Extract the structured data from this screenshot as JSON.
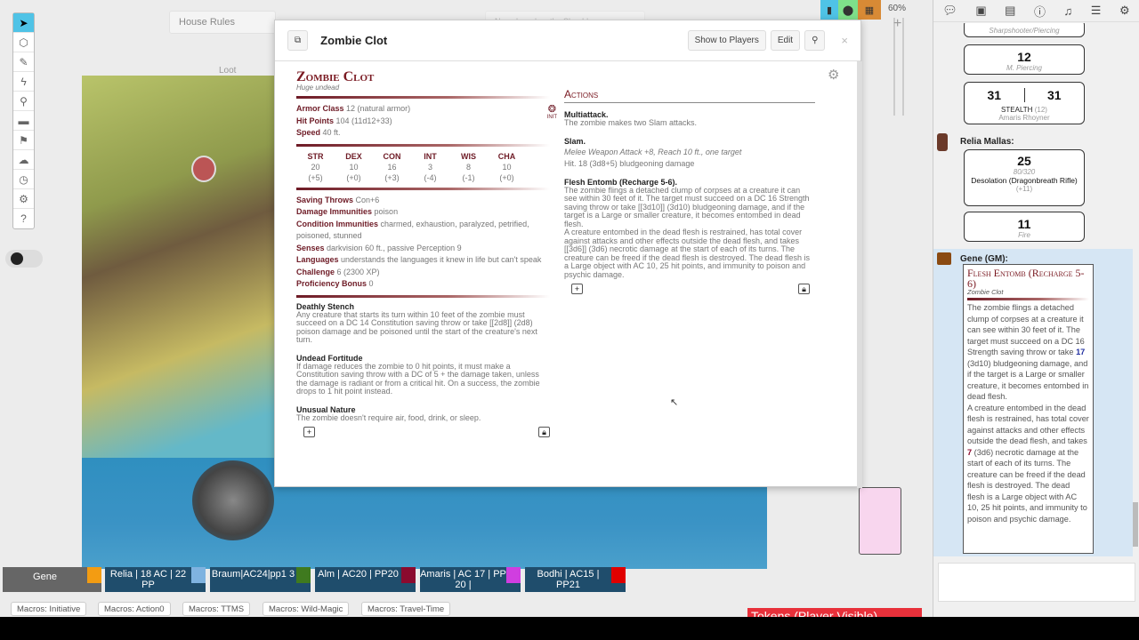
{
  "toolbar": {
    "icons": [
      "select-icon",
      "cube-icon",
      "brush-icon",
      "lightning-icon",
      "zoom-icon",
      "ruler-icon",
      "pin-icon",
      "fog-icon",
      "clock-icon",
      "dice-icon",
      "help-icon"
    ]
  },
  "pages": {
    "house_rules": "House Rules",
    "loot": "Loot",
    "shoulder": "Nemehaerd on the Shoulde"
  },
  "zoom": {
    "level": "60%"
  },
  "dialog": {
    "title": "Zombie Clot",
    "show_to_players": "Show to Players",
    "edit": "Edit"
  },
  "monster": {
    "name": "Zombie Clot",
    "type": "Huge undead",
    "ac_label": "Armor Class",
    "ac": "12 (natural armor)",
    "hp_label": "Hit Points",
    "hp": "104 (11d12+33)",
    "speed_label": "Speed",
    "speed": "40 ft.",
    "init": "INIT",
    "abilities": [
      {
        "n": "STR",
        "v": "20",
        "m": "(+5)"
      },
      {
        "n": "DEX",
        "v": "10",
        "m": "(+0)"
      },
      {
        "n": "CON",
        "v": "16",
        "m": "(+3)"
      },
      {
        "n": "INT",
        "v": "3",
        "m": "(-4)"
      },
      {
        "n": "WIS",
        "v": "8",
        "m": "(-1)"
      },
      {
        "n": "CHA",
        "v": "10",
        "m": "(+0)"
      }
    ],
    "props": [
      {
        "k": "Saving Throws",
        "v": "Con+6"
      },
      {
        "k": "Damage Immunities",
        "v": "poison"
      },
      {
        "k": "Condition Immunities",
        "v": "charmed, exhaustion, paralyzed, petrified, poisoned, stunned"
      },
      {
        "k": "Senses",
        "v": "darkvision 60 ft., passive Perception 9"
      },
      {
        "k": "Languages",
        "v": "understands the languages it knew in life but can't speak"
      },
      {
        "k": "Challenge",
        "v": "6 (2300 XP)"
      },
      {
        "k": "Proficiency Bonus",
        "v": "0"
      }
    ],
    "traits": [
      {
        "name": "Deathly Stench",
        "text": "Any creature that starts its turn within 10 feet of the zombie must succeed on a DC 14 Constitution saving throw or take [[2d8]] (2d8) poison damage and be poisoned until the start of the creature's next turn."
      },
      {
        "name": "Undead Fortitude",
        "text": "If damage reduces the zombie to 0 hit points, it must make a Constitution saving throw with a DC of 5 + the damage taken, unless the damage is radiant or from a critical hit. On a success, the zombie drops to 1 hit point instead."
      },
      {
        "name": "Unusual Nature",
        "text": "The zombie doesn't require air, food, drink, or sleep."
      }
    ],
    "actions_title": "Actions",
    "actions": [
      {
        "name": "Multiattack.",
        "lines": [
          "The zombie makes two Slam attacks."
        ]
      },
      {
        "name": "Slam.",
        "lines": [
          "Melee Weapon Attack +8, Reach 10 ft., one target",
          "Hit. 18 (3d8+5) bludgeoning damage"
        ]
      },
      {
        "name": "Flesh Entomb (Recharge 5-6).",
        "lines": [
          "The zombie flings a detached clump of corpses at a creature it can see within 30 feet of it. The target must succeed on a DC 16 Strength saving throw or take [[3d10]] (3d10) bludgeoning damage, and if the target is a Large or smaller creature, it becomes entombed in dead flesh.",
          "A creature entombed in the dead flesh is restrained, has total cover against attacks and other effects outside the dead flesh, and takes [[3d6]] (3d6) necrotic damage at the start of each of its turns. The creature can be freed if the dead flesh is destroyed. The dead flesh is a Large object with AC 10, 25 hit points, and immunity to poison and psychic damage."
        ]
      }
    ]
  },
  "chat": {
    "card_top": {
      "sub": "Sharpshooter/Piercing"
    },
    "card_12": {
      "n": "12",
      "s": "M. Piercing"
    },
    "card_stealth": {
      "a": "31",
      "b": "31",
      "label": "STEALTH",
      "mod": "(12)",
      "who": "Amaris Rhoyner"
    },
    "relia": {
      "who": "Relia Mallas:",
      "n": "25",
      "range": "80/320",
      "weapon": "Desolation (Dragonbreath Rifle)",
      "bonus": "(+11)",
      "dmg": "11",
      "dmg_type": "Fire"
    },
    "gene": {
      "who": "Gene (GM):",
      "title": "Flesh Entomb (Recharge 5-6)",
      "sub": "Zombie Clot",
      "t1": "The zombie flings a detached clump of corpses at a creature it can see within 30 feet of it. The target must succeed on a DC 16 Strength saving throw or take ",
      "r1": "17",
      "t2": " (3d10) bludgeoning damage, and if the target is a Large or smaller creature, it becomes entombed in dead flesh.",
      "t3": "A creature entombed in the dead flesh is restrained, has total cover against attacks and other effects outside the dead flesh, and takes ",
      "r2": "7",
      "t4": " (3d6) necrotic damage at the start of each of its turns. The creature can be freed if the dead flesh is destroyed. The dead flesh is a Large object with AC 10, 25 hit points, and immunity to poison and psychic damage."
    }
  },
  "players": [
    {
      "name": "Gene",
      "color": "#f39c12"
    },
    {
      "name": "Relia | 18 AC | 22 PP",
      "color": "#7fb3e0"
    },
    {
      "name": "Braum|AC24|pp1 3",
      "color": "#3f7a1f"
    },
    {
      "name": "Alm | AC20 | PP20",
      "color": "#8b0a2e"
    },
    {
      "name": "Amaris | AC 17 | PP 20 |",
      "color": "#d03ee0"
    },
    {
      "name": "Bodhi | AC15 | PP21",
      "color": "#e00000"
    }
  ],
  "macros": [
    "Macros: Initiative",
    "Macros: Action0",
    "Macros: TTMS",
    "Macros: Wild-Magic",
    "Macros: Travel-Time"
  ],
  "layer": "Tokens (Player Visible)"
}
